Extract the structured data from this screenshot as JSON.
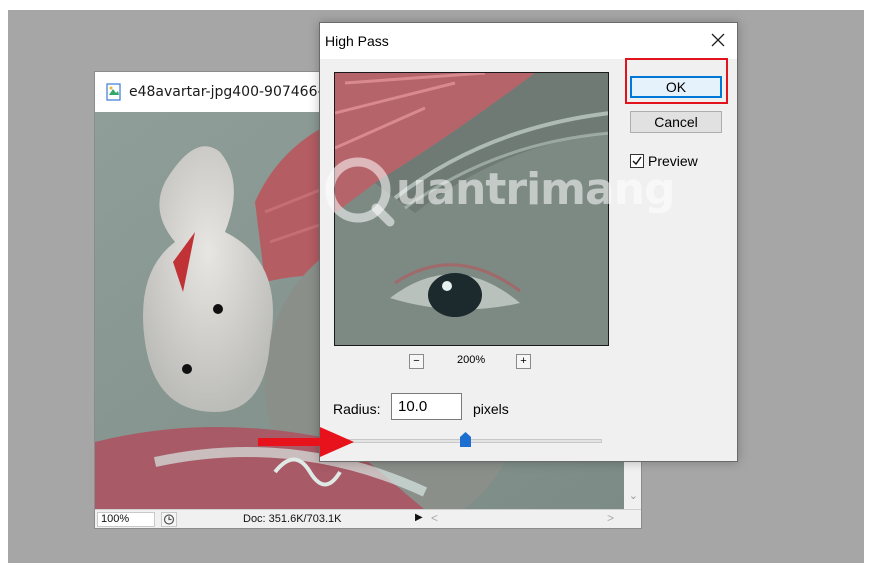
{
  "document_window": {
    "title": "e48avartar-jpg400-907466-",
    "zoom": "100%",
    "doc_size": "Doc: 351.6K/703.1K",
    "status_arrow": "▶",
    "scroll_left": "<",
    "scroll_right": ">",
    "scroll_down": "⌄"
  },
  "dialog": {
    "title": "High Pass",
    "ok_label": "OK",
    "cancel_label": "Cancel",
    "preview_label": "Preview",
    "preview_checked": true,
    "zoom_minus": "−",
    "zoom_plus": "+",
    "zoom_level": "200%",
    "radius_label": "Radius:",
    "radius_value": "10.0",
    "radius_unit": "pixels",
    "radius_slider_fraction": 0.47
  },
  "watermark": {
    "text": "uantrimang"
  },
  "colors": {
    "accent_blue": "#0078d7",
    "highlight_red": "#e1141e",
    "arrow_red": "#e8121c",
    "slider_thumb": "#1c6fd1"
  }
}
